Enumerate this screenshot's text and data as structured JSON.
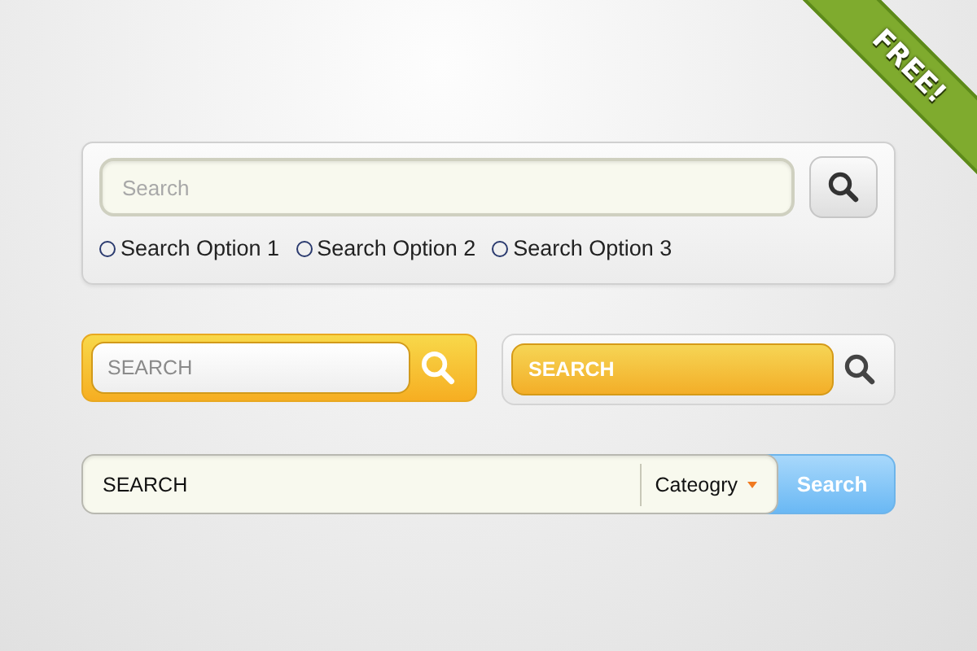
{
  "ribbon": {
    "label": "FREE!"
  },
  "search_panel": {
    "field": {
      "placeholder": "Search"
    },
    "options": [
      {
        "label": "Search Option 1",
        "selected": false
      },
      {
        "label": "Search Option 2",
        "selected": false
      },
      {
        "label": "Search Option 3",
        "selected": false
      }
    ]
  },
  "small_searches": [
    {
      "kind": "yellow_frame",
      "field": {
        "placeholder": "SEARCH"
      }
    },
    {
      "kind": "yellow_field",
      "field": {
        "placeholder": "SEARCH"
      }
    }
  ],
  "category_search": {
    "field": {
      "value": "SEARCH"
    },
    "category": "Cateogry",
    "button": "Search"
  }
}
